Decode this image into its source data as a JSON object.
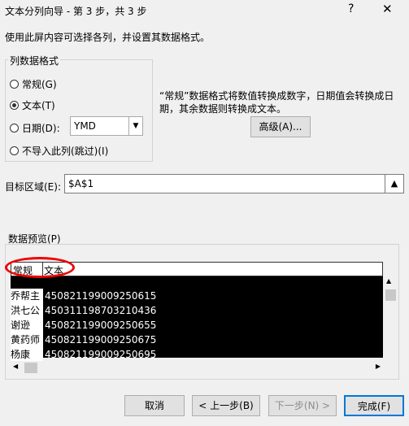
{
  "window": {
    "title": "文本分列向导 - 第 3 步，共 3 步",
    "help": "?",
    "close": "✕"
  },
  "instruction": "使用此屏内容可选择各列，并设置其数据格式。",
  "format_group": {
    "title": "列数据格式",
    "options": [
      {
        "label": "常规(G)",
        "checked": false
      },
      {
        "label": "文本(T)",
        "checked": true
      },
      {
        "label": "日期(D):",
        "checked": false
      },
      {
        "label": "不导入此列(跳过)(I)",
        "checked": false
      }
    ],
    "date_value": "YMD"
  },
  "description": "“常规”数据格式将数值转换成数字，日期值会转换成日期，其余数据则转换成文本。",
  "advanced_button": "高级(A)...",
  "target": {
    "label": "目标区域(E):",
    "value": "$A$1"
  },
  "preview": {
    "label": "数据预览(P)",
    "headers": [
      "常规",
      "文本"
    ],
    "rows": [
      {
        "name": "乔帮主",
        "id": "450821199009250615"
      },
      {
        "name": "洪七公",
        "id": "450311198703210436"
      },
      {
        "name": "谢逊",
        "id": "450821199009250655"
      },
      {
        "name": "黄药师",
        "id": "450821199009250675"
      },
      {
        "name": "杨康",
        "id": "450821199009250695"
      }
    ]
  },
  "buttons": {
    "cancel": "取消",
    "back": "< 上一步(B)",
    "next": "下一步(N) >",
    "finish": "完成(F)"
  }
}
